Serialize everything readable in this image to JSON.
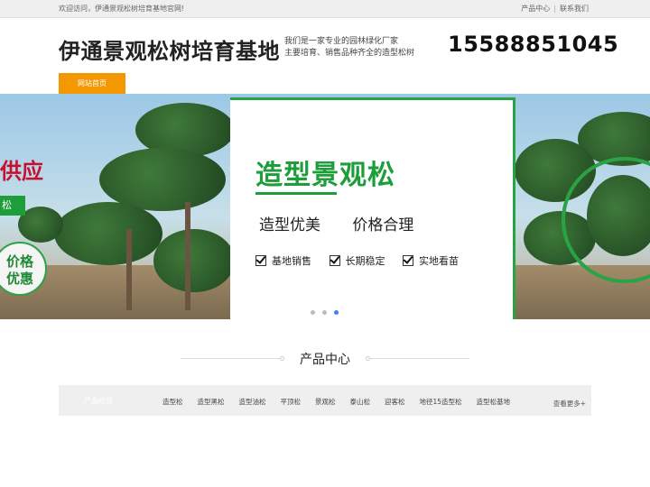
{
  "topbar": {
    "welcome": "欢迎访问，伊通景观松树培育基地官网!",
    "links": [
      "产品中心",
      "联系我们"
    ]
  },
  "header": {
    "title": "伊通景观松树培育基地",
    "slogan_line1": "我们是一家专业的园林绿化厂家",
    "slogan_line2": "主要培育、销售品种齐全的造型松树",
    "phone": "15588851045"
  },
  "nav": {
    "home_label": "网站首页"
  },
  "banner": {
    "left_red_text": "供应",
    "left_green_text": "松",
    "left_bubble_line1": "价格",
    "left_bubble_line2": "优惠",
    "heading": "造型景观松",
    "features": [
      "造型优美",
      "价格合理"
    ],
    "checks": [
      "基地销售",
      "长期稳定",
      "实地看苗"
    ],
    "slide_count": 3,
    "active_slide": 3
  },
  "products": {
    "section_title": "产品中心",
    "category_label": "产品栏目",
    "categories": [
      "造型松",
      "造型黑松",
      "造型油松",
      "平顶松",
      "景观松",
      "泰山松",
      "迎客松",
      "地径15造型松",
      "造型松基地"
    ],
    "more_label": "查看更多+"
  },
  "colors": {
    "accent_orange": "#f39800",
    "brand_green": "#1e9e3a",
    "active_dot": "#3b82f6"
  }
}
